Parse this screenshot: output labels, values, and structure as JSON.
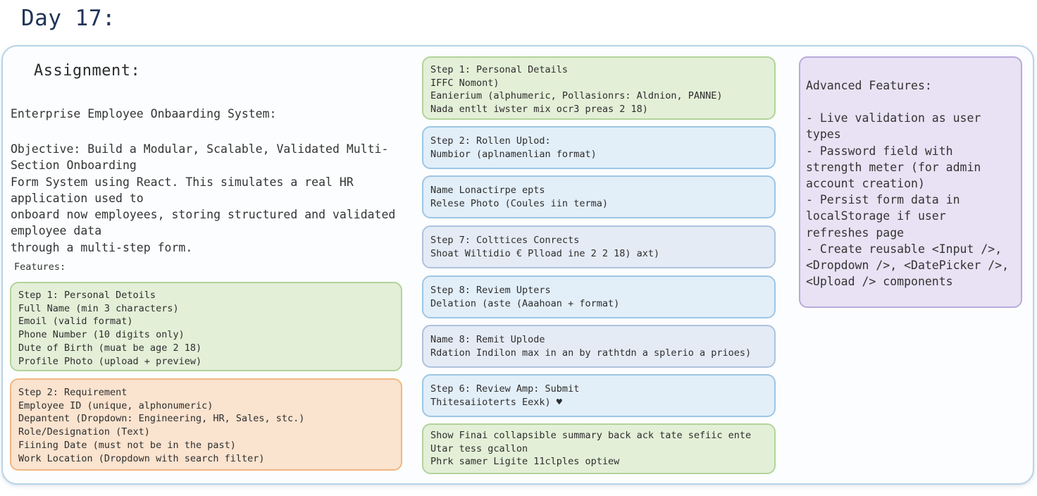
{
  "page_title": "Day 17:",
  "assignment": {
    "title": "Assignment:",
    "system_title": "Enterprise Employee Onbaarding System:",
    "objective_lines": [
      "Objective: Build a Modular, Scalable, Validated Multi-",
      "Section Onboarding",
      "Form System using React. This simulates a real HR",
      "application used to",
      "onboard now employees, storing structured and validated",
      "employee data",
      "through a multi-step form."
    ],
    "features_label": "Features:"
  },
  "left_boxes": [
    {
      "lines": [
        "Step 1: Personal Detoils",
        "Full Name (min 3 characters)",
        "Emoil (valid format)",
        "Phone Number (10 digits only)",
        "Dute of Birth (muat be age 2 18)",
        "Profile Photo (upload + preview)"
      ]
    },
    {
      "lines": [
        "Step 2: Requirement",
        "Employee ID (unique, alphonumeric)",
        "Depantent (Dropdown: Engineering, HR, Sales, stc.)",
        "Role/Designation (Text)",
        "Fiining Date (must not be in the past)",
        "Work Location (Dropdown with search filter)"
      ]
    }
  ],
  "middle_boxes": [
    {
      "lines": [
        "Step 1: Personal Details",
        "IFFC Nomont)",
        "Eanierium (alphumeric, Pollasionrs: Aldnion, PANNE)",
        "Nada entlt iwster mix ocr3 preas 2 18)"
      ]
    },
    {
      "lines": [
        "Step 2: Rollen Uplod:",
        "Numbior (aplnamenlian format)"
      ]
    },
    {
      "lines": [
        "Name Lonactirpe epts",
        "Relese Photo (Coules iin terma)"
      ]
    },
    {
      "lines": [
        "Step 7: Colttices Conrects",
        "Shoat Wiltidio € Plload ine 2 2 18) axt)"
      ]
    },
    {
      "lines": [
        "Step 8: Reviem Upters",
        "Delation (aste (Aaahoan + format)"
      ]
    },
    {
      "lines": [
        "Name 8: Remit Uplode",
        "Rdation Indilon max in an by rathtdn a splerio a prioes)"
      ]
    },
    {
      "lines": [
        "Step 6: Review Amp: Submit",
        "Thitesaiioterts Eexk) ♥"
      ]
    },
    {
      "lines": [
        "Show Finai collapsible summary back ack tate sefiic ente",
        "Utar tess gcallon",
        "Phrk samer Ligite 11clples optiew"
      ]
    }
  ],
  "advanced": {
    "title": "Advanced Features:",
    "items": [
      "- Live validation as user types",
      "- Password field with strength meter (for admin account creation)",
      "- Persist form data in localStorage if user refreshes page",
      "- Create reusable <Input />, <Dropdown />, <DatePicker />, <Upload /> components"
    ]
  }
}
